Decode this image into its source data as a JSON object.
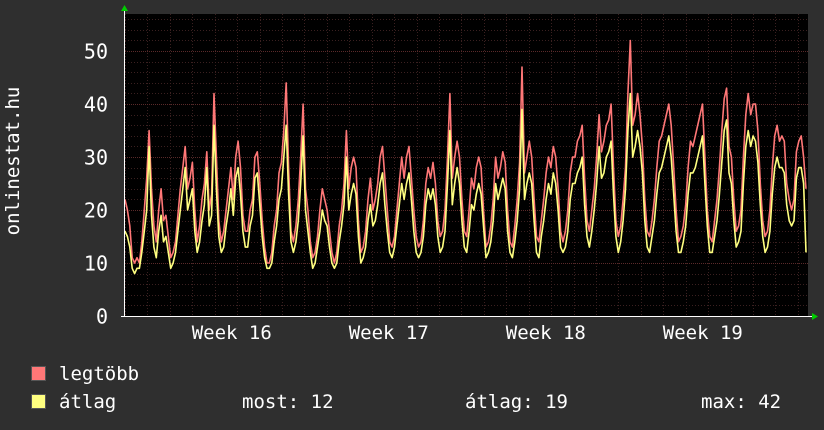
{
  "chart_data": {
    "type": "line",
    "ylabel": "onlinestat.hu",
    "ylim": [
      0,
      57
    ],
    "yticks": [
      0,
      10,
      20,
      30,
      40,
      50
    ],
    "x_categories": [
      "Week 16",
      "Week 17",
      "Week 18",
      "Week 19"
    ],
    "grid": true,
    "legend_placement": "bottom-left",
    "series": [
      {
        "name": "legtöbb",
        "color": "#ff7777",
        "values": [
          22,
          20,
          17,
          11,
          10,
          11,
          10,
          14,
          20,
          26,
          35,
          24,
          17,
          14,
          20,
          24,
          18,
          19,
          15,
          11,
          12,
          14,
          19,
          24,
          28,
          32,
          24,
          26,
          29,
          20,
          14,
          17,
          22,
          25,
          31,
          20,
          23,
          42,
          30,
          18,
          14,
          16,
          20,
          24,
          28,
          22,
          30,
          33,
          28,
          19,
          16,
          16,
          20,
          22,
          30,
          31,
          25,
          18,
          13,
          10,
          10,
          12,
          17,
          20,
          27,
          29,
          35,
          44,
          28,
          16,
          14,
          17,
          22,
          30,
          40,
          24,
          20,
          14,
          11,
          12,
          15,
          20,
          24,
          22,
          20,
          16,
          12,
          10,
          12,
          17,
          20,
          25,
          35,
          24,
          28,
          30,
          28,
          18,
          12,
          13,
          16,
          22,
          26,
          20,
          22,
          25,
          30,
          32,
          26,
          20,
          14,
          13,
          15,
          20,
          25,
          30,
          26,
          30,
          32,
          26,
          20,
          15,
          13,
          14,
          18,
          25,
          28,
          26,
          29,
          25,
          18,
          15,
          16,
          20,
          30,
          42,
          26,
          30,
          33,
          30,
          22,
          16,
          15,
          20,
          26,
          24,
          28,
          30,
          28,
          20,
          13,
          14,
          17,
          22,
          30,
          26,
          28,
          31,
          29,
          20,
          14,
          13,
          17,
          22,
          29,
          47,
          27,
          30,
          33,
          30,
          22,
          15,
          14,
          18,
          22,
          27,
          30,
          28,
          32,
          30,
          24,
          16,
          14,
          16,
          20,
          27,
          30,
          30,
          33,
          34,
          36,
          26,
          18,
          16,
          20,
          24,
          30,
          38,
          31,
          33,
          36,
          37,
          40,
          28,
          18,
          15,
          17,
          22,
          28,
          42,
          52,
          36,
          38,
          42,
          38,
          32,
          22,
          16,
          15,
          18,
          22,
          28,
          33,
          34,
          36,
          38,
          40,
          36,
          28,
          20,
          14,
          15,
          17,
          21,
          28,
          33,
          32,
          34,
          36,
          38,
          40,
          30,
          20,
          15,
          14,
          18,
          22,
          28,
          35,
          41,
          43,
          32,
          30,
          22,
          16,
          17,
          20,
          30,
          38,
          42,
          38,
          40,
          40,
          35,
          25,
          18,
          15,
          16,
          20,
          28,
          34,
          36,
          33,
          34,
          33,
          25,
          22,
          20,
          22,
          31,
          33,
          34,
          30,
          24
        ],
        "min": 10,
        "max": 52
      },
      {
        "name": "átlag",
        "color": "#ffff80",
        "values": [
          16,
          15,
          13,
          9,
          8,
          9,
          9,
          12,
          16,
          20,
          32,
          19,
          13,
          11,
          16,
          19,
          14,
          15,
          12,
          9,
          10,
          12,
          16,
          20,
          24,
          28,
          20,
          22,
          24,
          16,
          12,
          14,
          18,
          21,
          28,
          17,
          19,
          36,
          24,
          15,
          12,
          13,
          17,
          20,
          24,
          19,
          26,
          28,
          23,
          16,
          13,
          13,
          17,
          19,
          26,
          27,
          21,
          15,
          11,
          9,
          9,
          10,
          14,
          17,
          22,
          24,
          30,
          36,
          23,
          14,
          12,
          14,
          18,
          25,
          34,
          20,
          16,
          12,
          9,
          10,
          13,
          16,
          20,
          18,
          17,
          13,
          10,
          9,
          10,
          14,
          17,
          21,
          30,
          20,
          23,
          25,
          23,
          15,
          10,
          11,
          13,
          18,
          21,
          17,
          18,
          21,
          25,
          27,
          21,
          16,
          12,
          11,
          13,
          17,
          21,
          25,
          22,
          25,
          27,
          22,
          16,
          12,
          11,
          12,
          15,
          21,
          24,
          22,
          24,
          21,
          15,
          12,
          13,
          16,
          25,
          35,
          21,
          25,
          28,
          25,
          18,
          13,
          12,
          16,
          21,
          20,
          23,
          25,
          23,
          17,
          11,
          12,
          14,
          18,
          25,
          22,
          24,
          26,
          24,
          16,
          12,
          11,
          14,
          18,
          24,
          39,
          22,
          25,
          27,
          25,
          18,
          12,
          11,
          15,
          18,
          22,
          25,
          23,
          27,
          25,
          20,
          13,
          12,
          13,
          16,
          22,
          25,
          25,
          27,
          28,
          30,
          21,
          15,
          13,
          16,
          20,
          25,
          32,
          26,
          27,
          30,
          31,
          33,
          23,
          15,
          12,
          14,
          18,
          24,
          35,
          42,
          30,
          32,
          35,
          32,
          27,
          18,
          13,
          12,
          15,
          18,
          23,
          27,
          28,
          30,
          32,
          34,
          30,
          23,
          16,
          12,
          12,
          14,
          17,
          23,
          27,
          27,
          28,
          30,
          32,
          34,
          25,
          17,
          12,
          12,
          15,
          18,
          23,
          29,
          35,
          37,
          27,
          25,
          18,
          13,
          14,
          16,
          25,
          32,
          35,
          32,
          34,
          33,
          29,
          21,
          15,
          12,
          13,
          16,
          23,
          28,
          30,
          28,
          28,
          27,
          21,
          18,
          17,
          18,
          26,
          28,
          28,
          25,
          12
        ],
        "min": 7,
        "max": 42
      }
    ]
  },
  "legend": {
    "items": [
      {
        "label": "legtöbb",
        "color": "#ff7777"
      },
      {
        "label": "átlag",
        "color": "#ffff80"
      }
    ]
  },
  "stats": {
    "now_label": "most:",
    "now_value": "12",
    "avg_label": "átlag:",
    "avg_value": "19",
    "max_label": "max:",
    "max_value": "42"
  }
}
